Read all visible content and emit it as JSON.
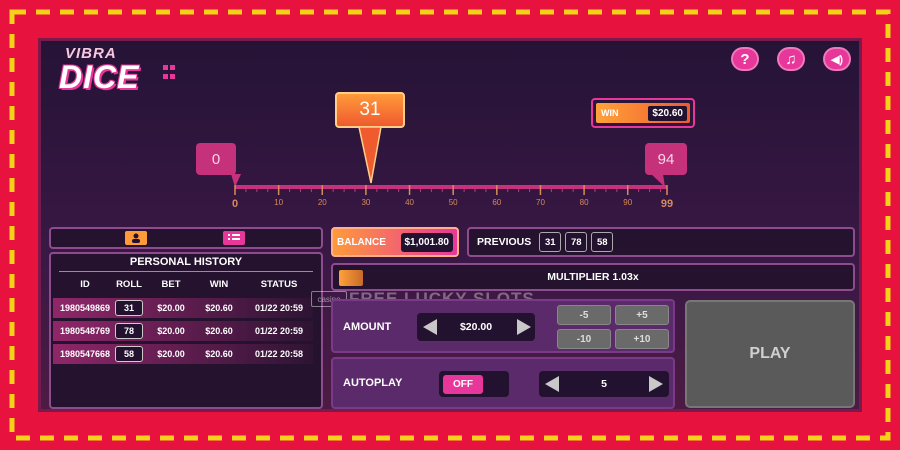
{
  "logo": {
    "top": "VIBRA",
    "main": "DICE"
  },
  "top_buttons": [
    {
      "name": "help-button",
      "glyph": "?"
    },
    {
      "name": "music-button",
      "glyph": "♫"
    },
    {
      "name": "sound-button",
      "glyph": "◀)"
    }
  ],
  "slider": {
    "target": "31",
    "low_marker": "0",
    "high_marker": "94",
    "ticks": [
      "0",
      "10",
      "20",
      "30",
      "40",
      "50",
      "60",
      "70",
      "80",
      "90",
      "99"
    ]
  },
  "win": {
    "label": "WIN",
    "value": "$20.60"
  },
  "history": {
    "title": "PERSONAL HISTORY",
    "columns": [
      "ID",
      "ROLL",
      "BET",
      "WIN",
      "STATUS"
    ],
    "rows": [
      {
        "id": "1980549869",
        "roll": "31",
        "bet": "$20.00",
        "win": "$20.60",
        "status": "01/22 20:59"
      },
      {
        "id": "1980548769",
        "roll": "78",
        "bet": "$20.00",
        "win": "$20.60",
        "status": "01/22 20:59"
      },
      {
        "id": "1980547668",
        "roll": "58",
        "bet": "$20.00",
        "win": "$20.60",
        "status": "01/22 20:58"
      }
    ]
  },
  "balance": {
    "label": "BALANCE",
    "value": "$1,001.80"
  },
  "previous": {
    "label": "PREVIOUS",
    "values": [
      "31",
      "78",
      "58"
    ]
  },
  "multiplier": {
    "label": "MULTIPLIER 1.03x"
  },
  "watermark": {
    "badge": "casino",
    "text": "FREE LUCKY SLOTS"
  },
  "amount": {
    "label": "AMOUNT",
    "value": "$20.00"
  },
  "steps": [
    "-5",
    "+5",
    "-10",
    "+10"
  ],
  "autoplay": {
    "label": "AUTOPLAY",
    "toggle": "OFF",
    "count": "5"
  },
  "play_label": "PLAY",
  "colors": {
    "frame": "#e8123f",
    "accent": "#e8379a",
    "orange": "#ef5a2f"
  }
}
